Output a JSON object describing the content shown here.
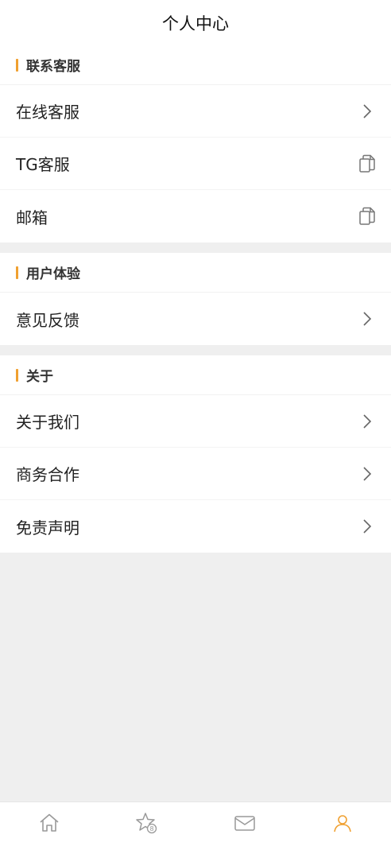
{
  "header": {
    "title": "个人中心"
  },
  "sections": [
    {
      "title": "联系客服",
      "rows": [
        {
          "label": "在线客服",
          "trail": "chevron-right-icon"
        },
        {
          "label": "TG客服",
          "trail": "copy-icon"
        },
        {
          "label": "邮箱",
          "trail": "copy-icon"
        }
      ]
    },
    {
      "title": "用户体验",
      "rows": [
        {
          "label": "意见反馈",
          "trail": "chevron-right-icon"
        }
      ]
    },
    {
      "title": "关于",
      "rows": [
        {
          "label": "关于我们",
          "trail": "chevron-right-icon"
        },
        {
          "label": "商务合作",
          "trail": "chevron-right-icon"
        },
        {
          "label": "免责声明",
          "trail": "chevron-right-icon"
        }
      ]
    }
  ],
  "tabbar": {
    "items": [
      {
        "icon": "home-icon"
      },
      {
        "icon": "star-badge-icon"
      },
      {
        "icon": "mail-icon"
      },
      {
        "icon": "user-icon"
      }
    ]
  },
  "colors": {
    "accent": "#f0a030",
    "background": "#efefef"
  }
}
